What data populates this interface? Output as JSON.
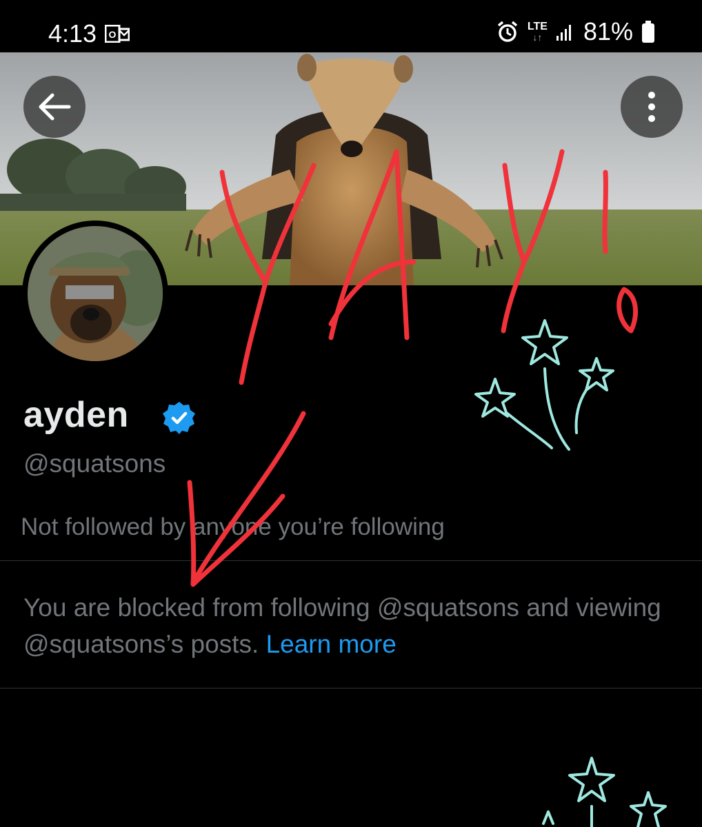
{
  "status_bar": {
    "time": "4:13",
    "network": "LTE",
    "battery": "81%"
  },
  "icons": {
    "back": "arrow-left-icon",
    "more": "more-vertical-icon",
    "verified": "verified-badge-icon"
  },
  "profile": {
    "name": "ayden",
    "handle": "@squatsons",
    "followed_by": "Not followed by anyone you’re following",
    "blocked_notice": "You are blocked from following @squatsons and viewing @squatsons’s posts.",
    "learn_more": "Learn more"
  },
  "annotation": {
    "text": "YAY!"
  },
  "colors": {
    "background": "#000000",
    "accent": "#1d9bf0",
    "secondary_text": "#71767b",
    "annotation_red": "#f0323a",
    "annotation_stars": "#9fe8e0"
  }
}
